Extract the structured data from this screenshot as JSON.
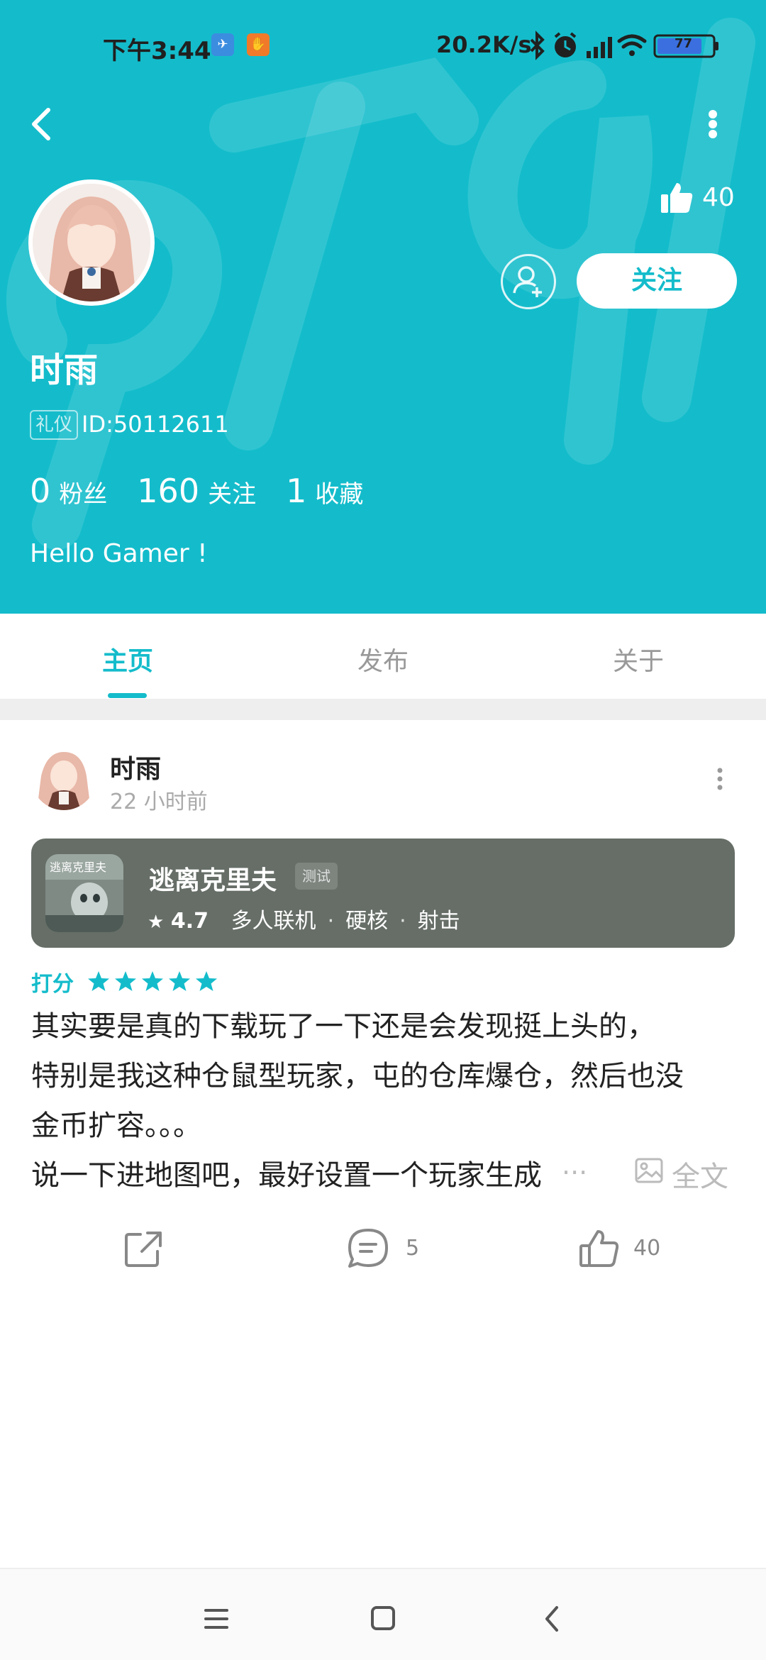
{
  "status_bar": {
    "time": "下午3:44",
    "net_speed": "20.2K/s",
    "battery": "77",
    "icons": [
      "bluetooth-icon",
      "alarm-icon",
      "signal-icon",
      "wifi-icon",
      "battery-icon"
    ]
  },
  "header": {
    "like_count": "40",
    "follow_label": "关注",
    "username": "时雨",
    "badge": "礼仪",
    "user_id": "ID:50112611",
    "bio": "Hello Gamer !",
    "stats": [
      {
        "num": "0",
        "label": "粉丝"
      },
      {
        "num": "160",
        "label": "关注"
      },
      {
        "num": "1",
        "label": "收藏"
      }
    ],
    "accent_color": "#14bccb"
  },
  "tabs": [
    {
      "label": "主页",
      "active": true
    },
    {
      "label": "发布",
      "active": false
    },
    {
      "label": "关于",
      "active": false
    }
  ],
  "post": {
    "author": "时雨",
    "time": "22 小时前",
    "game": {
      "title": "逃离克里夫",
      "tag": "测试",
      "icon_text": "逃离克里夫",
      "score": "4.7",
      "genres": [
        "多人联机",
        "硬核",
        "射击"
      ]
    },
    "rating_label": "打分",
    "rating_stars": 5,
    "body_lines": [
      "其实要是真的下载玩了一下还是会发现挺上头的，",
      "特别是我这种仓鼠型玩家，屯的仓库爆仓，然后也没",
      "金币扩容。。。",
      "说一下进地图吧，最好设置一个玩家生成"
    ],
    "ellipsis": "...",
    "full_text_label": "全文",
    "comment_count": "5",
    "like_count": "40"
  }
}
